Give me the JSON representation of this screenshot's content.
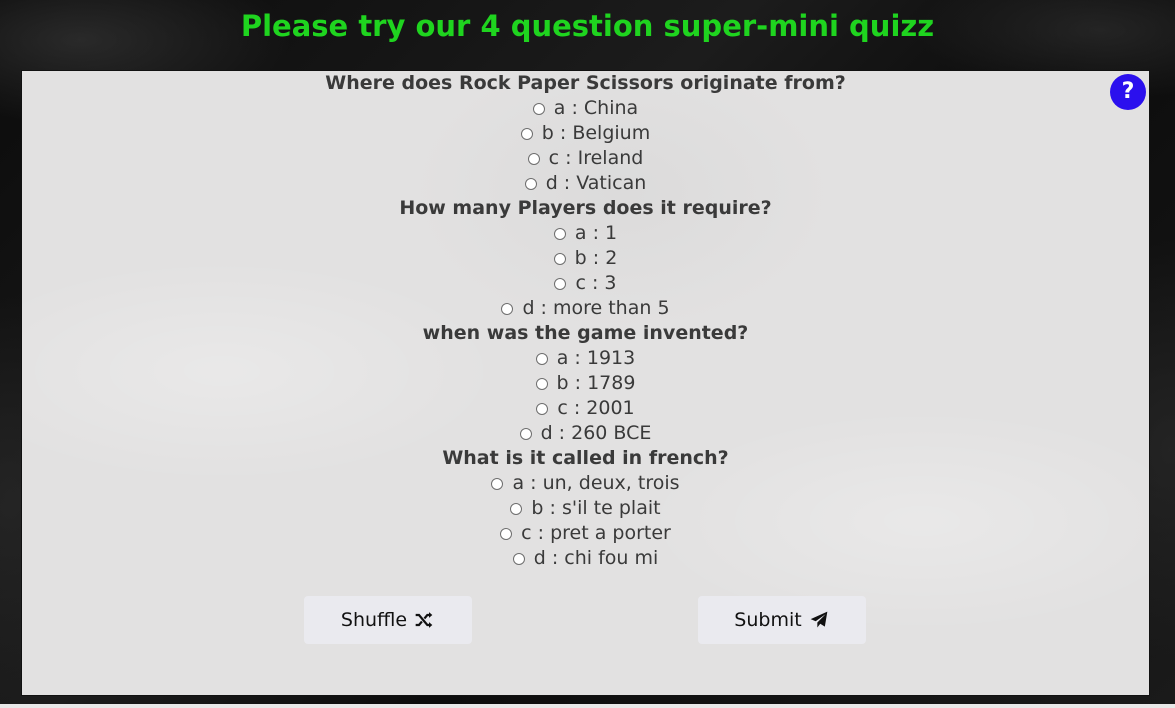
{
  "page": {
    "title": "Please try our 4 question super-mini quizz"
  },
  "help": {
    "label": "?"
  },
  "questions": [
    {
      "text": "Where does Rock Paper Scissors originate from?",
      "options": [
        "a : China",
        "b : Belgium",
        "c : Ireland",
        "d : Vatican"
      ]
    },
    {
      "text": "How many Players does it require?",
      "options": [
        "a : 1",
        "b : 2",
        "c : 3",
        "d : more than 5"
      ]
    },
    {
      "text": "when was the game invented?",
      "options": [
        "a : 1913",
        "b : 1789",
        "c : 2001",
        "d : 260 BCE"
      ]
    },
    {
      "text": "What is it called in french?",
      "options": [
        "a : un, deux, trois",
        "b : s'il te plait",
        "c : pret a porter",
        "d : chi fou mi"
      ]
    }
  ],
  "buttons": {
    "shuffle_label": "Shuffle",
    "shuffle_icon": "shuffle-icon",
    "submit_label": "Submit",
    "submit_icon": "paper-plane-icon"
  },
  "colors": {
    "title": "#1fd41f",
    "help": "#2b10ee",
    "panel": "#e2e1e1"
  }
}
